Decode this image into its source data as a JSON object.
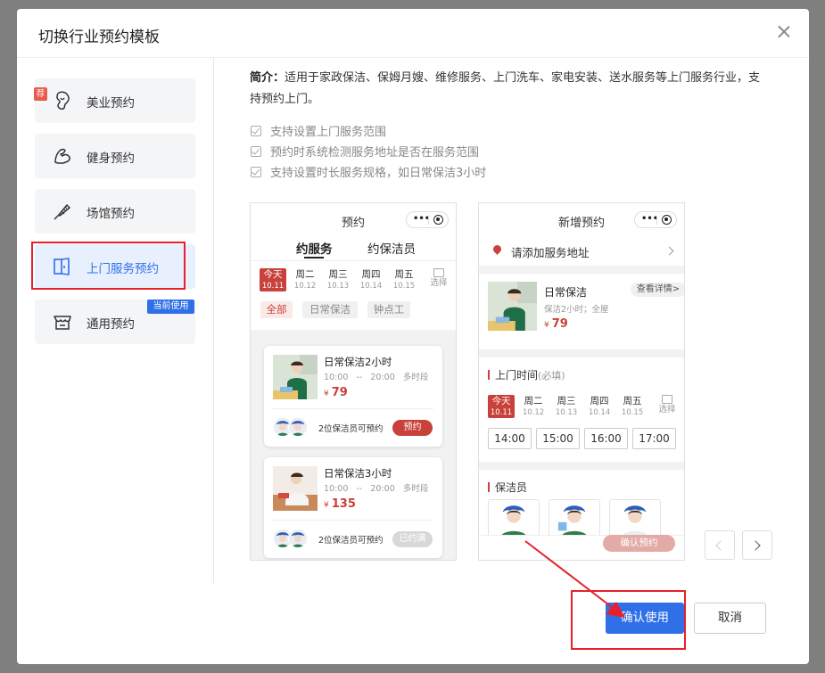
{
  "dialog": {
    "title": "切换行业预约模板",
    "close_icon": "close-icon"
  },
  "sidebar": {
    "items": [
      {
        "label": "美业预约",
        "icon": "beauty-icon"
      },
      {
        "label": "健身预约",
        "icon": "fitness-icon"
      },
      {
        "label": "场馆预约",
        "icon": "badminton-icon"
      },
      {
        "label": "上门服务预约",
        "icon": "door-icon"
      },
      {
        "label": "通用预约",
        "icon": "store-icon"
      }
    ],
    "hot_badge": "荐",
    "current_badge": "当前使用",
    "active_index": 3
  },
  "description": {
    "label": "简介：",
    "text": "适用于家政保洁、保姆月嫂、维修服务、上门洗车、家电安装、送水服务等上门服务行业，支持预约上门。",
    "features": [
      "支持设置上门服务范围",
      "预约时系统检测服务地址是否在服务范围",
      "支持设置时长服务规格，如日常保洁3小时"
    ]
  },
  "phone1": {
    "title": "预约",
    "tabs": [
      "约服务",
      "约保洁员"
    ],
    "days": [
      {
        "name": "今天",
        "date": "10.11"
      },
      {
        "name": "周二",
        "date": "10.12"
      },
      {
        "name": "周三",
        "date": "10.13"
      },
      {
        "name": "周四",
        "date": "10.14"
      },
      {
        "name": "周五",
        "date": "10.15"
      }
    ],
    "select_label": "选择",
    "chips": [
      "全部",
      "日常保洁",
      "钟点工"
    ],
    "cards": [
      {
        "name": "日常保洁2小时",
        "start": "10:00",
        "dash": "--",
        "end": "20:00",
        "slot": "多时段",
        "currency": "¥",
        "price": "79",
        "staff": "2位保洁员可预约",
        "action": "预约"
      },
      {
        "name": "日常保洁3小时",
        "start": "10:00",
        "dash": "--",
        "end": "20:00",
        "slot": "多时段",
        "currency": "¥",
        "price": "135",
        "staff": "2位保洁员可预约",
        "action": "已约满"
      }
    ]
  },
  "phone2": {
    "title": "新增预约",
    "address_placeholder": "请添加服务地址",
    "service": {
      "name": "日常保洁",
      "detail": "保洁2小时；全屋",
      "currency": "¥",
      "price": "79",
      "view_details": "查看详情>"
    },
    "time_section": "上门时间",
    "time_required": "(必填)",
    "days": [
      {
        "name": "今天",
        "date": "10.11"
      },
      {
        "name": "周二",
        "date": "10.12"
      },
      {
        "name": "周三",
        "date": "10.13"
      },
      {
        "name": "周四",
        "date": "10.14"
      },
      {
        "name": "周五",
        "date": "10.15"
      }
    ],
    "select_label": "选择",
    "slots": [
      "14:00",
      "15:00",
      "16:00",
      "17:00"
    ],
    "cleaner_section": "保洁员",
    "confirm": "确认预约"
  },
  "footer": {
    "confirm": "确认使用",
    "cancel": "取消"
  },
  "colors": {
    "primary": "#2f6fe8",
    "accent_red": "#c8413a",
    "annotation_red": "#e8202a"
  }
}
